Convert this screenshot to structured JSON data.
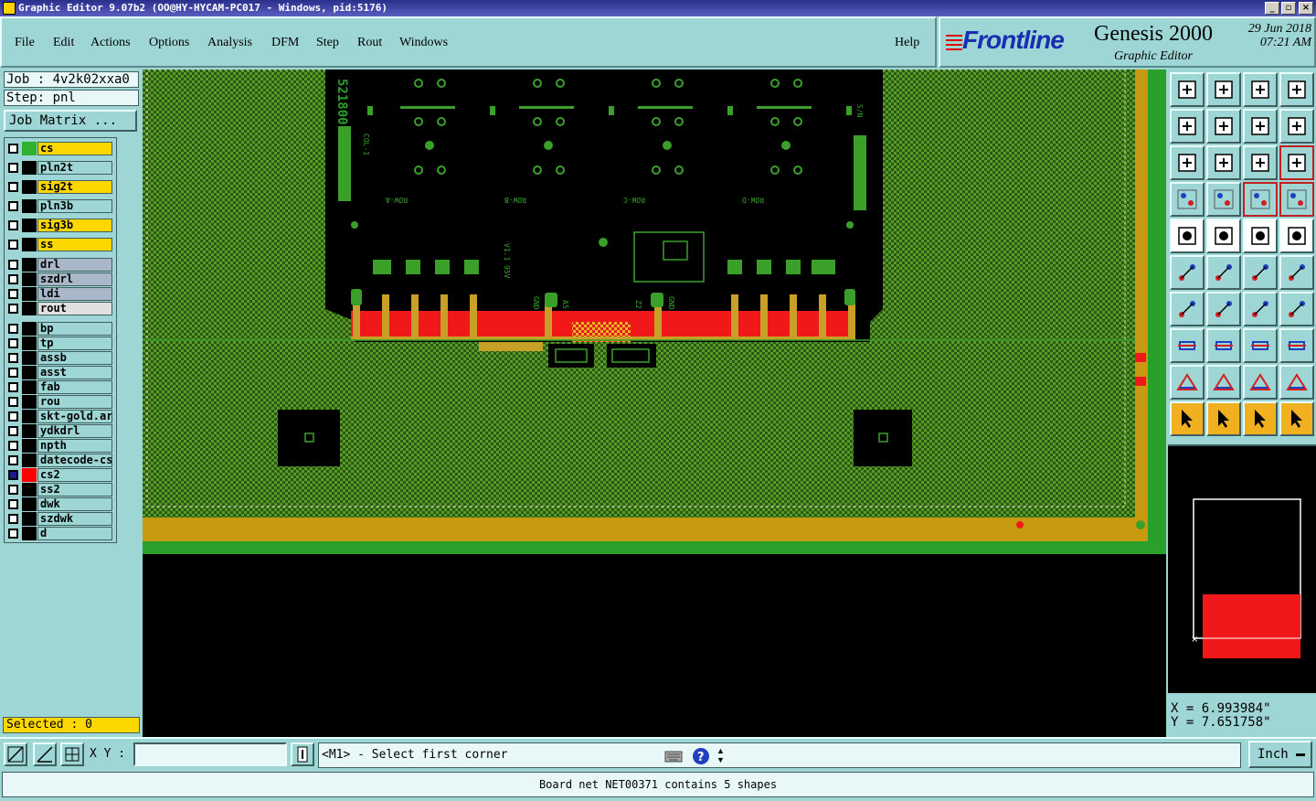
{
  "window": {
    "title": "Graphic Editor 9.07b2 (OO@HY-HYCAM-PC017 - Windows, pid:5176)"
  },
  "menu": {
    "items": [
      "File",
      "Edit",
      "Actions",
      "Options",
      "Analysis",
      "DFM",
      "Step",
      "Rout",
      "Windows"
    ],
    "help": "Help"
  },
  "branding": {
    "logo": "Frontline",
    "product": "Genesis 2000",
    "subtitle": "Graphic Editor",
    "date": "29 Jun 2018",
    "time": "07:21 AM"
  },
  "job": {
    "job": "Job : 4v2k02xxa0",
    "step": "Step: pnl",
    "matrix_button": "Job Matrix ..."
  },
  "layers": [
    {
      "name": "cs",
      "color": "#ffd700",
      "swatch": "#2fb02f",
      "group": 0
    },
    {
      "name": "pln2t",
      "color": "#9ed6d6",
      "swatch": "#000000",
      "group": 0
    },
    {
      "name": "sig2t",
      "color": "#ffd700",
      "swatch": "#000000",
      "group": 0
    },
    {
      "name": "pln3b",
      "color": "#9ed6d6",
      "swatch": "#000000",
      "group": 0
    },
    {
      "name": "sig3b",
      "color": "#ffd700",
      "swatch": "#000000",
      "group": 0
    },
    {
      "name": "ss",
      "color": "#ffd700",
      "swatch": "#000000",
      "group": 0
    },
    {
      "name": "drl",
      "color": "#a8b8c8",
      "swatch": "#000000",
      "group": 1
    },
    {
      "name": "szdrl",
      "color": "#a8b8c8",
      "swatch": "#000000",
      "group": 1
    },
    {
      "name": "ldi",
      "color": "#a8b8c8",
      "swatch": "#000000",
      "group": 1
    },
    {
      "name": "rout",
      "color": "#e0e0e0",
      "swatch": "#000000",
      "group": 1
    },
    {
      "name": "bp",
      "color": "#9ed6d6",
      "swatch": "#000000",
      "group": 2
    },
    {
      "name": "tp",
      "color": "#9ed6d6",
      "swatch": "#000000",
      "group": 2
    },
    {
      "name": "assb",
      "color": "#9ed6d6",
      "swatch": "#000000",
      "group": 2
    },
    {
      "name": "asst",
      "color": "#9ed6d6",
      "swatch": "#000000",
      "group": 2
    },
    {
      "name": "fab",
      "color": "#9ed6d6",
      "swatch": "#000000",
      "group": 2
    },
    {
      "name": "rou",
      "color": "#9ed6d6",
      "swatch": "#000000",
      "group": 2
    },
    {
      "name": "skt-gold.art",
      "color": "#9ed6d6",
      "swatch": "#000000",
      "group": 2
    },
    {
      "name": "ydkdrl",
      "color": "#9ed6d6",
      "swatch": "#000000",
      "group": 2
    },
    {
      "name": "npth",
      "color": "#9ed6d6",
      "swatch": "#000000",
      "group": 2
    },
    {
      "name": "datecode-cs",
      "color": "#9ed6d6",
      "swatch": "#000000",
      "group": 2
    },
    {
      "name": "cs2",
      "color": "#9ed6d6",
      "swatch": "#ff0000",
      "group": 2,
      "active": true
    },
    {
      "name": "ss2",
      "color": "#9ed6d6",
      "swatch": "#000000",
      "group": 2
    },
    {
      "name": "dwk",
      "color": "#9ed6d6",
      "swatch": "#000000",
      "group": 2
    },
    {
      "name": "szdwk",
      "color": "#9ed6d6",
      "swatch": "#000000",
      "group": 2
    },
    {
      "name": "d",
      "color": "#9ed6d6",
      "swatch": "#000000",
      "group": 2
    }
  ],
  "selected": "Selected : 0",
  "canvas": {
    "board_text": "521800",
    "silk_labels": [
      "COL-1",
      "S/N",
      "ROW-A",
      "ROW-B",
      "ROW-C",
      "ROW-D",
      "V1.1 95V",
      "GND",
      "A5",
      "Z2",
      "GND"
    ]
  },
  "toolbox": {
    "icons": [
      "zoom-home-icon",
      "zoom-page-icon",
      "home-icon",
      "split-view-icon",
      "pan-left-icon",
      "pan-right-icon",
      "undo-icon",
      "redo-icon",
      "zoom-fit-icon",
      "zoom-center-icon",
      "scale-1-2-icon",
      "help-icon",
      "settings-icon",
      "grid-icon",
      "snap-icon",
      "net-icon",
      "measure-icon",
      "draw-shape-icon",
      "ruler-icon",
      "pad-icon",
      "connect-icon",
      "cross-icon",
      "point-icon",
      "point2-icon",
      "angle-icon",
      "line-icon",
      "arc-icon",
      "mirror-icon",
      "select-red-icon",
      "minus-icon",
      "fit-icon",
      "blue-shapes-icon",
      "triangle-icon",
      "triangle2-icon",
      "triangle3-icon",
      "triangle4-icon",
      "arrow-select-icon",
      "arrow-select2-icon",
      "arrow-select3-icon",
      "move-icon"
    ]
  },
  "coords": {
    "x": "X = 6.993984\"",
    "y": "Y = 7.651758\""
  },
  "bottom": {
    "xy_label": "X Y :",
    "xy_value": "",
    "prompt": "<M1> - Select first corner",
    "unit": "Inch"
  },
  "status": "Board net NET00371 contains 5 shapes"
}
